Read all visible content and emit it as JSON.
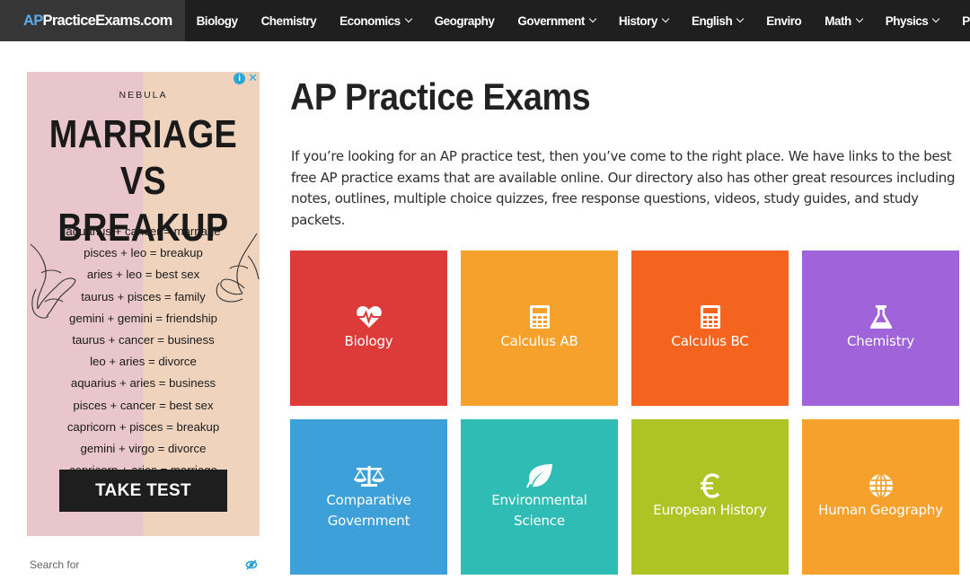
{
  "nav": {
    "brand_ap": "AP",
    "brand_rest": "PracticeExams.com",
    "items": [
      {
        "label": "Biology",
        "dropdown": false
      },
      {
        "label": "Chemistry",
        "dropdown": false
      },
      {
        "label": "Economics",
        "dropdown": true
      },
      {
        "label": "Geography",
        "dropdown": false
      },
      {
        "label": "Government",
        "dropdown": true
      },
      {
        "label": "History",
        "dropdown": true
      },
      {
        "label": "English",
        "dropdown": true
      },
      {
        "label": "Enviro",
        "dropdown": false
      },
      {
        "label": "Math",
        "dropdown": true
      },
      {
        "label": "Physics",
        "dropdown": true
      },
      {
        "label": "Psychology",
        "dropdown": false
      }
    ]
  },
  "ad": {
    "brand": "NEBULA",
    "headline_1": "MARRIAGE",
    "headline_2": "VS BREAKUP",
    "lines": [
      "aquarius + cancer = marriage",
      "pisces + leo = breakup",
      "aries + leo = best sex",
      "taurus + pisces = family",
      "gemini + gemini = friendship",
      "taurus + cancer = business",
      "leo + aries = divorce",
      "aquarius + aries = business",
      "pisces + cancer = best sex",
      "capricorn + pisces = breakup",
      "gemini + virgo = divorce",
      "capricorn + aries = marriage"
    ],
    "cta": "TAKE TEST",
    "colors": {
      "left_bg": "#e8c6cb",
      "right_bg": "#efd3bd",
      "cta_bg": "#1e1e1e"
    }
  },
  "search": {
    "placeholder": "Search for"
  },
  "main": {
    "title": "AP Practice Exams",
    "intro": "If you’re looking for an AP practice test, then you’ve come to the right place. We have links to the best free AP practice exams that are available online. Our directory also has other great resources including notes, outlines, multiple choice quizzes, free response questions, videos, study guides, and study packets."
  },
  "tiles": [
    {
      "label_1": "Biology",
      "label_2": "",
      "icon": "heartbeat-icon",
      "color": "#dd3a3a"
    },
    {
      "label_1": "Calculus AB",
      "label_2": "",
      "icon": "calculator-icon",
      "color": "#f6a12b"
    },
    {
      "label_1": "Calculus BC",
      "label_2": "",
      "icon": "calculator-icon",
      "color": "#f4641f"
    },
    {
      "label_1": "Chemistry",
      "label_2": "",
      "icon": "flask-icon",
      "color": "#a163d9"
    },
    {
      "label_1": "Comparative",
      "label_2": "Government",
      "icon": "balance-scale-icon",
      "color": "#3ea0d8"
    },
    {
      "label_1": "Environmental",
      "label_2": "Science",
      "icon": "leaf-icon",
      "color": "#2fbcb4"
    },
    {
      "label_1": "European History",
      "label_2": "",
      "icon": "euro-icon",
      "color": "#aec324"
    },
    {
      "label_1": "Human Geography",
      "label_2": "",
      "icon": "globe-icon",
      "color": "#f6a12b"
    }
  ]
}
